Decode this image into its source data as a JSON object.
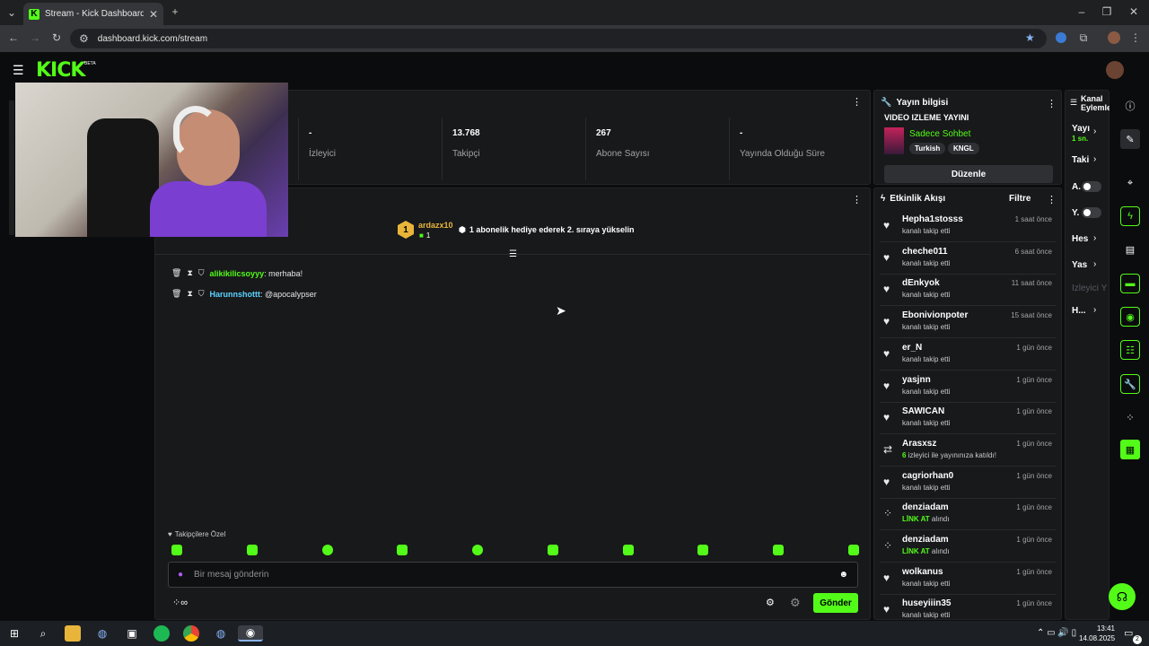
{
  "browser": {
    "tab_title": "Stream - Kick Dashboard",
    "url": "dashboard.kick.com/stream"
  },
  "logo": {
    "text": "KICK",
    "badge": "BETA"
  },
  "stats": [
    {
      "value": "-",
      "label": "İzleyici"
    },
    {
      "value": "13.768",
      "label": "Takipçi"
    },
    {
      "value": "267",
      "label": "Abone Sayısı"
    },
    {
      "value": "-",
      "label": "Yayında Olduğu Süre"
    }
  ],
  "chat": {
    "leader": {
      "user": "ardazx10",
      "count": "1",
      "rank": "1"
    },
    "promo": "1 abonelik hediye ederek 2. sıraya yükselin",
    "messages": [
      {
        "user": "alikikilicsoyyy",
        "text": ": merhaba!",
        "color": "#53fc18"
      },
      {
        "user": "Harunnshottt",
        "text": ": @apocalypser",
        "color": "#5ad3ff"
      }
    ],
    "follower_only": "Takipçilere Özel",
    "input_placeholder": "Bir mesaj gönderin",
    "send_label": "Gönder"
  },
  "info": {
    "title": "Yayın bilgisi",
    "stream_title": "VIDEO IZLEME YAYINI",
    "category": "Sadece Sohbet",
    "tags": [
      "Turkish",
      "KNGL"
    ],
    "edit_label": "Düzenle"
  },
  "events": {
    "title": "Etkinlik Akışı",
    "filter": "Filtre",
    "items": [
      {
        "name": "Hepha1stosss",
        "sub": "kanalı takip etti",
        "time": "1 saat önce",
        "icon": "heart-icon"
      },
      {
        "name": "cheche011",
        "sub": "kanalı takip etti",
        "time": "6 saat önce",
        "icon": "heart-icon"
      },
      {
        "name": "dEnkyok",
        "sub": "kanalı takip etti",
        "time": "11 saat önce",
        "icon": "heart-icon"
      },
      {
        "name": "Ebonivionpoter",
        "sub": "kanalı takip etti",
        "time": "15 saat önce",
        "icon": "heart-icon"
      },
      {
        "name": "er_N",
        "sub": "kanalı takip etti",
        "time": "1 gün önce",
        "icon": "heart-icon"
      },
      {
        "name": "yasjnn",
        "sub": "kanalı takip etti",
        "time": "1 gün önce",
        "icon": "heart-icon"
      },
      {
        "name": "SAWICAN",
        "sub": "kanalı takip etti",
        "time": "1 gün önce",
        "icon": "heart-icon"
      },
      {
        "name": "Arasxsz",
        "sub_hl": "6",
        "sub": " izleyici ile yayınınıza katıldı!",
        "time": "1 gün önce",
        "icon": "host-icon"
      },
      {
        "name": "cagriorhan0",
        "sub": "kanalı takip etti",
        "time": "1 gün önce",
        "icon": "heart-icon"
      },
      {
        "name": "denziadam",
        "sub_hl": "LİNK AT",
        "sub": " alındı",
        "time": "1 gün önce",
        "icon": "reward-icon"
      },
      {
        "name": "denziadam",
        "sub_hl": "LİNK AT",
        "sub": " alındı",
        "time": "1 gün önce",
        "icon": "reward-icon"
      },
      {
        "name": "wolkanus",
        "sub": "kanalı takip etti",
        "time": "1 gün önce",
        "icon": "heart-icon"
      },
      {
        "name": "huseyiiin35",
        "sub": "kanalı takip etti",
        "time": "1 gün önce",
        "icon": "heart-icon"
      }
    ]
  },
  "actions": {
    "title": "Kanal Eylemle",
    "items": [
      "Yayı",
      "1 sn.",
      "Taki",
      "A.",
      "Y.",
      "Hes",
      "Yas",
      "İzleyici Y",
      "H..."
    ]
  },
  "taskbar": {
    "time": "13:41",
    "date": "14.08.2025",
    "notif": "2"
  }
}
